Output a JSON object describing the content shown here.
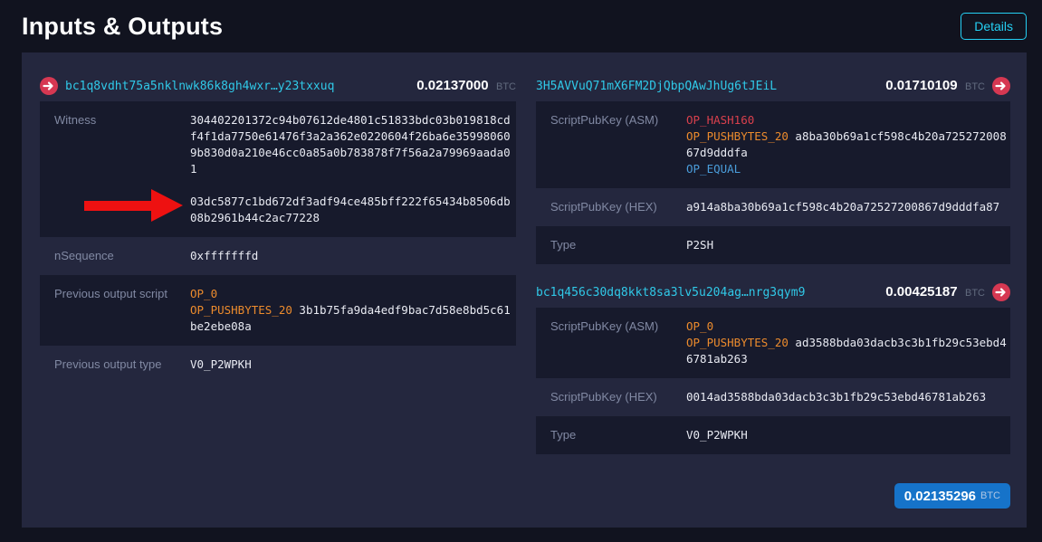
{
  "header": {
    "title": "Inputs & Outputs",
    "details_label": "Details"
  },
  "input": {
    "address": "bc1q8vdht75a5nklnwk86k8gh4wxr…y23txxuq",
    "amount": "0.02137000",
    "currency": "BTC",
    "witness": {
      "label": "Witness",
      "item1": "304402201372c94b07612de4801c51833bdc03b019818cdf4f1da7750e61476f3a2a362e0220604f26ba6e359980609b830d0a210e46cc0a85a0b783878f7f56a2a79969aada01",
      "item2": "03dc5877c1bd672df3adf94ce485bff222f65434b8506db08b2961b44c2ac77228"
    },
    "nsequence": {
      "label": "nSequence",
      "value": "0xfffffffd"
    },
    "prev_script": {
      "label": "Previous output script",
      "op_0": "OP_0",
      "op_pushbytes": "OP_PUSHBYTES_20",
      "hex": "3b1b75fa9da4edf9bac7d58e8bd5c61be2ebe08a"
    },
    "prev_type": {
      "label": "Previous output type",
      "value": "V0_P2WPKH"
    }
  },
  "outputs": [
    {
      "address": "3H5AVVuQ71mX6FM2DjQbpQAwJhUg6tJEiL",
      "amount": "0.01710109",
      "currency": "BTC",
      "asm": {
        "label": "ScriptPubKey (ASM)",
        "op_hash160": "OP_HASH160",
        "op_pushbytes": "OP_PUSHBYTES_20",
        "hex": "a8ba30b69a1cf598c4b20a72527200867d9dddfa",
        "op_equal": "OP_EQUAL"
      },
      "hex": {
        "label": "ScriptPubKey (HEX)",
        "value": "a914a8ba30b69a1cf598c4b20a72527200867d9dddfa87"
      },
      "type": {
        "label": "Type",
        "value": "P2SH"
      }
    },
    {
      "address": "bc1q456c30dq8kkt8sa3lv5u204ag…nrg3qym9",
      "amount": "0.00425187",
      "currency": "BTC",
      "asm": {
        "label": "ScriptPubKey (ASM)",
        "op_0": "OP_0",
        "op_pushbytes": "OP_PUSHBYTES_20",
        "hex": "ad3588bda03dacb3c3b1fb29c53ebd46781ab263"
      },
      "hex": {
        "label": "ScriptPubKey (HEX)",
        "value": "0014ad3588bda03dacb3c3b1fb29c53ebd46781ab263"
      },
      "type": {
        "label": "Type",
        "value": "V0_P2WPKH"
      }
    }
  ],
  "total": {
    "amount": "0.02135296",
    "currency": "BTC"
  },
  "colors": {
    "page_background": "#11131f",
    "panel_background": "#24273e",
    "row_dark": "#171a2c",
    "address_cyan": "#30c9e8",
    "details_cyan": "#25d0f4",
    "op_orange": "#ec8b2d",
    "op_red": "#d9404d",
    "op_blue": "#4a9ddb",
    "io_icon_red": "#d63852",
    "total_button_blue": "#1673c9",
    "annotation_red": "#ee1111"
  }
}
